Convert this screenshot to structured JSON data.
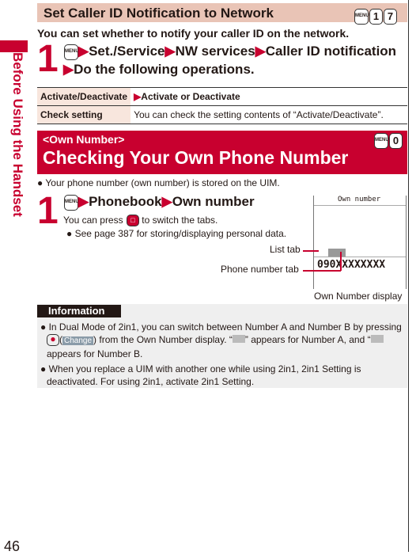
{
  "side_tab": "Before Using the Handset",
  "page_number": "46",
  "section1": {
    "title": "Set Caller ID Notification to Network",
    "keys": [
      "MENU",
      "1",
      "7"
    ],
    "intro": "You can set whether to notify your caller ID on the network.",
    "step_number": "1",
    "step_key": "MENU",
    "step_items": [
      "Set./Service",
      "NW services",
      "Caller ID notification",
      "Do the following operations."
    ],
    "table": [
      {
        "key": "Activate/Deactivate",
        "value": "Activate or Deactivate",
        "arrow": true
      },
      {
        "key": "Check setting",
        "value": "You can check the setting contents of “Activate/Deactivate”."
      }
    ]
  },
  "section2": {
    "subtitle": "<Own Number>",
    "title": "Checking Your Own Phone Number",
    "keys": [
      "MENU",
      "0"
    ],
    "bullet": "Your phone number (own number) is stored on the UIM.",
    "step_number": "1",
    "step_key": "MENU",
    "step_items": [
      "Phonebook",
      "Own number"
    ],
    "note_before": "You can press",
    "note_after": "to switch the tabs.",
    "bullet2": "See page 387 for storing/displaying personal data.",
    "screen": {
      "title": "Own number",
      "number": "090XXXXXXXX",
      "caption": "Own Number display",
      "list_tab_label": "List tab",
      "phone_tab_label": "Phone number tab"
    }
  },
  "information": {
    "label": "Information",
    "item1_a": "In Dual Mode of 2in1, you can switch between Number A and Number B by pressing",
    "item1_soft": "Change",
    "item1_b": ") from the Own Number display. “",
    "item1_c": "” appears for Number A, and “",
    "item1_d": "” appears for Number B.",
    "item2": "When you replace a UIM with another one while using 2in1, 2in1 Setting is deactivated. For using 2in1, activate 2in1 Setting."
  },
  "colors": {
    "accent": "#c8002f",
    "header_bg": "#e9c4b6",
    "table_key_bg": "#f8e6dd",
    "info_bg": "#efefef"
  }
}
